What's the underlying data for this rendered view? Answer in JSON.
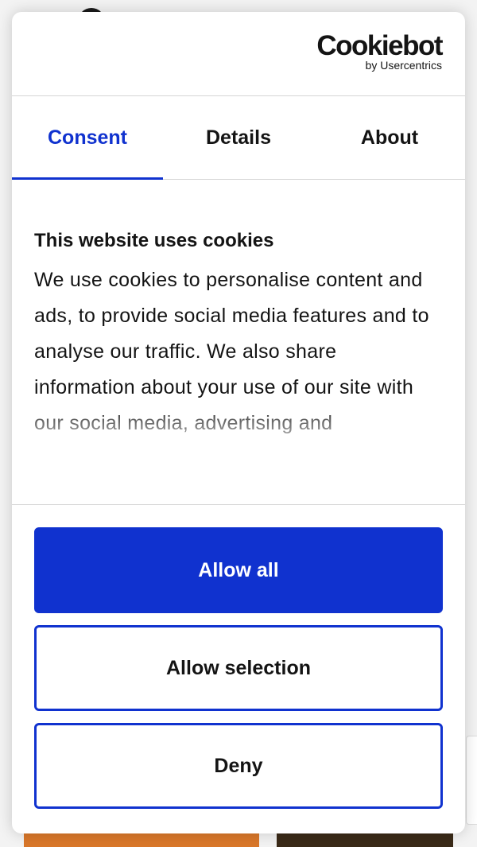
{
  "brand": {
    "name": "Cookiebot",
    "tagline": "by Usercentrics"
  },
  "tabs": [
    {
      "label": "Consent",
      "active": true
    },
    {
      "label": "Details",
      "active": false
    },
    {
      "label": "About",
      "active": false
    }
  ],
  "consent": {
    "heading": "This website uses cookies",
    "body": "We use cookies to personalise content and ads, to provide social media features and to analyse our traffic. We also share information about your use of our site with our social media, advertising and"
  },
  "buttons": {
    "allow_all": "Allow all",
    "allow_selection": "Allow selection",
    "deny": "Deny"
  },
  "colors": {
    "accent": "#1032cf",
    "text": "#141414"
  }
}
